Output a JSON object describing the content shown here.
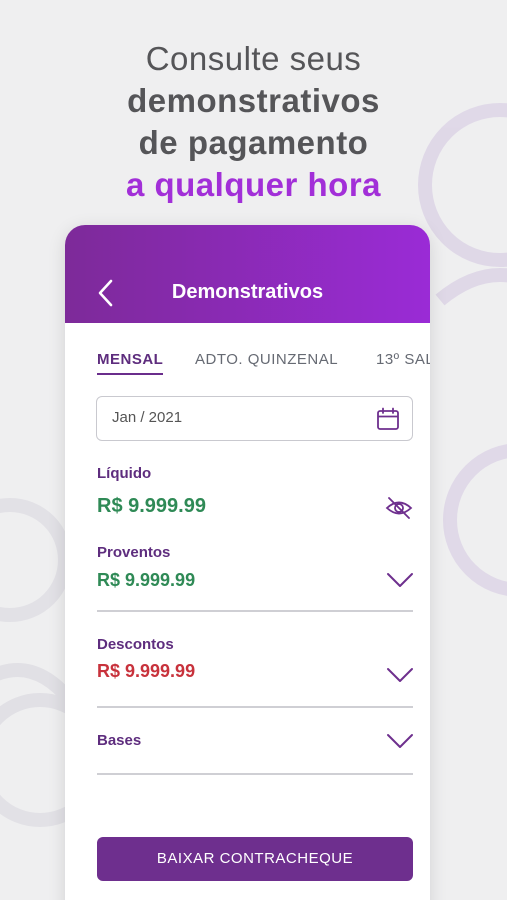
{
  "promo": {
    "line1": "Consulte seus",
    "line2": "demonstrativos",
    "line3": "de pagamento",
    "line4": "a qualquer hora"
  },
  "appbar": {
    "title": "Demonstrativos",
    "back_icon": "chevron-left-icon"
  },
  "tabs": [
    {
      "label": "MENSAL",
      "active": true
    },
    {
      "label": "ADTO. QUINZENAL",
      "active": false
    },
    {
      "label": "13º SAL",
      "active": false
    }
  ],
  "date_field": {
    "value": "Jan / 2021",
    "icon": "calendar-icon"
  },
  "liquido": {
    "label": "Líquido",
    "value": "R$ 9.999.99",
    "icon": "eye-off-icon"
  },
  "proventos": {
    "label": "Proventos",
    "value": "R$ 9.999.99"
  },
  "descontos": {
    "label": "Descontos",
    "value": "R$ 9.999.99"
  },
  "bases": {
    "label": "Bases"
  },
  "download_button": {
    "label": "BAIXAR CONTRACHEQUE"
  },
  "colors": {
    "accent": "#9a2bd6",
    "primary": "#6e2f8e",
    "positive": "#2f8a56",
    "negative": "#c8323c"
  }
}
